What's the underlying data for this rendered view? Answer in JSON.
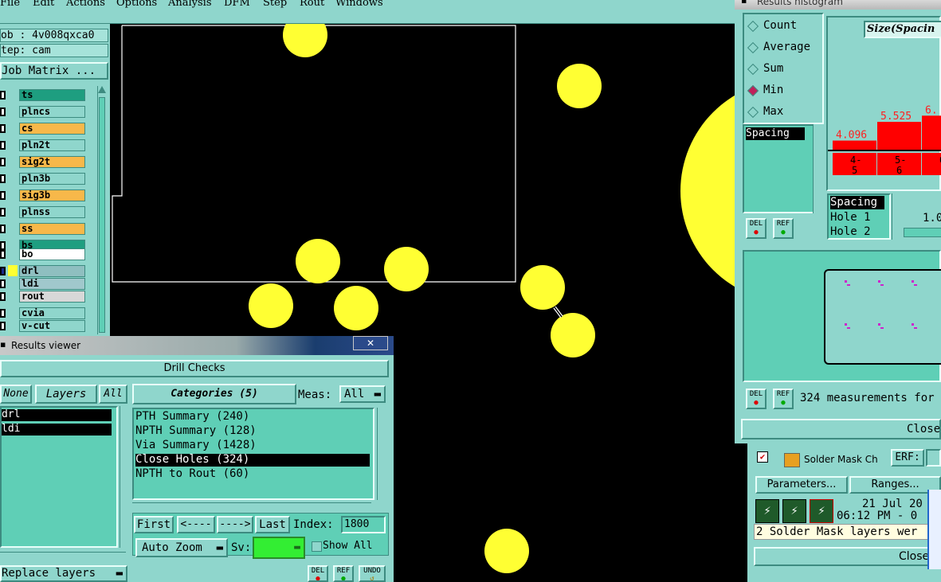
{
  "menubar": {
    "items": [
      "File",
      "Edit",
      "Actions",
      "Options",
      "Analysis",
      "DFM",
      "Step",
      "Rout",
      "Windows"
    ]
  },
  "job": {
    "job_label": "ob : 4v008qxca0",
    "step_label": "tep: cam",
    "matrix_button": "Job Matrix ..."
  },
  "layers": [
    {
      "name": "ts",
      "color": "#1e9e80",
      "mark": true
    },
    {
      "name": "plncs",
      "color": "#8fd6cc",
      "mark": false
    },
    {
      "name": "cs",
      "color": "#f7b84a",
      "mark": true
    },
    {
      "name": "pln2t",
      "color": "#8fd6cc",
      "mark": false
    },
    {
      "name": "sig2t",
      "color": "#f7b84a",
      "mark": true
    },
    {
      "name": "pln3b",
      "color": "#8fd6cc",
      "mark": false
    },
    {
      "name": "sig3b",
      "color": "#f7b84a",
      "mark": true
    },
    {
      "name": "plnss",
      "color": "#8fd6cc",
      "mark": false
    },
    {
      "name": "ss",
      "color": "#f7b84a",
      "mark": true
    },
    {
      "name": "bs",
      "color": "#1e9e80",
      "mark": true
    },
    {
      "name": "bo",
      "color": "#ffffff",
      "mark": false
    },
    {
      "name": "drl",
      "color": "#8fbfc0",
      "mark": true
    },
    {
      "name": "ldi",
      "color": "#a0c8cc",
      "mark": false
    },
    {
      "name": "rout",
      "color": "#d8d8d8",
      "mark": false
    },
    {
      "name": "cvia",
      "color": "#8fd6cc",
      "mark": false
    },
    {
      "name": "v-cut",
      "color": "#8fd6cc",
      "mark": false
    }
  ],
  "results_viewer": {
    "window_title": "Results viewer",
    "close_glyph": "✕",
    "section_title": "Drill Checks",
    "none_button": "None",
    "layers_label": "Layers",
    "all_button": "All",
    "layer_list": [
      "drl",
      "ldi"
    ],
    "categories_label": "Categories (5)",
    "meas_label": "Meas:",
    "meas_value": "All",
    "categories": [
      {
        "label": "PTH Summary (240)",
        "selected": false
      },
      {
        "label": "NPTH Summary (128)",
        "selected": false
      },
      {
        "label": "Via Summary (1428)",
        "selected": false
      },
      {
        "label": "Close Holes (324)",
        "selected": true
      },
      {
        "label": "NPTH to Rout (60)",
        "selected": false
      }
    ],
    "first_button": "First",
    "prev_button": "<----",
    "next_button": "---->",
    "last_button": "Last",
    "index_label": "Index:",
    "index_value": "1800",
    "auto_zoom": "Auto Zoom",
    "sv_label": "Sv:",
    "show_all_label": "Show All",
    "replace_layers": "Replace layers",
    "del_label": "DEL",
    "ref_label": "REF",
    "undo_label": "UNDO"
  },
  "histogram": {
    "window_title": "Results histogram",
    "options": [
      {
        "label": "Count",
        "selected": false
      },
      {
        "label": "Average",
        "selected": false
      },
      {
        "label": "Sum",
        "selected": false
      },
      {
        "label": "Min",
        "selected": true
      },
      {
        "label": "Max",
        "selected": false
      }
    ],
    "size_title": "Size(Spacin",
    "spacing_item": "Spacing",
    "metrics_list": [
      "Spacing",
      "Hole 1",
      "Hole 2"
    ],
    "scale_value": "1.0",
    "measurements_text": "324 measurements for",
    "close_button": "Close",
    "del_label": "DEL",
    "ref_label": "REF"
  },
  "chart_data": {
    "type": "bar",
    "categories": [
      "4-5",
      "5-6",
      "6"
    ],
    "values": [
      4.096,
      5.525,
      6.0
    ],
    "value_labels": [
      "4.096",
      "5.525",
      "6."
    ],
    "bar_color": "#ff0000"
  },
  "solder": {
    "title": "Solder Mask Ch",
    "erf_label": "ERF:",
    "parameters_button": "Parameters...",
    "ranges_button": "Ranges...",
    "date_text": "21 Jul 20",
    "time_text": "06:12 PM - 0",
    "message": "2 Solder Mask layers wer",
    "close_button": "Close"
  },
  "colors": {
    "panel": "#8fd6cc",
    "panel_dark": "#5fcfb6",
    "pad": "#ffff33",
    "canvas": "#000000"
  }
}
